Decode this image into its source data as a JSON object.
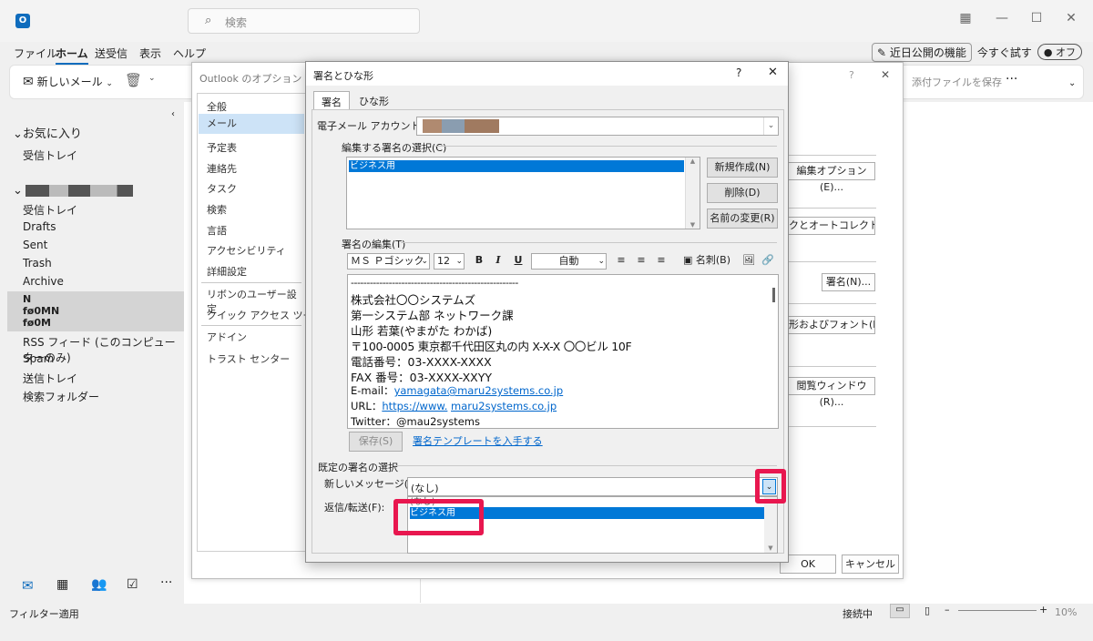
{
  "titlebar": {
    "search_placeholder": "検索"
  },
  "menu": {
    "file": "ファイル",
    "home": "ホーム",
    "sendrecv": "送受信",
    "view": "表示",
    "help": "ヘルプ"
  },
  "top_right": {
    "coming_soon": "近日公開の機能",
    "try_now": "今すぐ試す",
    "toggle": "オフ"
  },
  "ribbon": {
    "new_mail": "新しいメール",
    "save_attachment": "添付ファイルを保存",
    "more": "···"
  },
  "leftpane": {
    "favorites": "お気に入り",
    "fav_inbox": "受信トレイ",
    "folders": [
      "受信トレイ",
      "Drafts",
      "Sent",
      "Trash",
      "Archive"
    ],
    "sel_lines": [
      "N",
      "fø0MN",
      "fø0M"
    ],
    "more_folders": [
      "RSS フィード (このコンピューターのみ)",
      "Spam",
      "送信トレイ",
      "検索フォルダー"
    ]
  },
  "status": {
    "left": "フィルター適用",
    "connected": "接続中",
    "zoom": "10%"
  },
  "options": {
    "title": "Outlook のオプション",
    "nav": [
      "全般",
      "メール",
      "予定表",
      "連絡先",
      "タスク",
      "検索",
      "言語",
      "アクセシビリティ",
      "詳細設定",
      "リボンのユーザー設定",
      "クイック アクセス ツール バー",
      "アドイン",
      "トラスト センター"
    ],
    "buttons": {
      "edit_options": "編集オプション(E)...",
      "autocorrect": "クとオートコレクト(S)...",
      "signature": "署名(N)...",
      "fonts": "形およびフォント(F)...",
      "reading": "閲覧ウィンドウ(R)..."
    },
    "ok": "OK",
    "cancel": "キャンセル"
  },
  "sig": {
    "title": "署名とひな形",
    "help": "?",
    "close": "✕",
    "tab_sig": "署名",
    "tab_tpl": "ひな形",
    "account_label": "電子メール アカウント(A):",
    "select_label": "編集する署名の選択(C)",
    "list_items": [
      "ビジネス用"
    ],
    "btn_new": "新規作成(N)",
    "btn_delete": "削除(D)",
    "btn_rename": "名前の変更(R)",
    "edit_label": "署名の編集(T)",
    "font": "ＭＳ Ｐゴシック",
    "size": "12",
    "color": "自動",
    "bizcard": "名刺(B)",
    "body": {
      "dash": "-----------------------------------------------------",
      "company": "株式会社〇〇システムズ",
      "dept": "第一システム部 ネットワーク課",
      "name": "山形 若葉(やまがた わかば)",
      "address": "〒100-0005 東京都千代田区丸の内 X-X-X 〇〇ビル 10F",
      "tel": "電話番号：03-XXXX-XXXX",
      "fax": "FAX 番号：03-XXXX-XXYY",
      "email_prefix": "E-mail：",
      "email": "yamagata@maru2systems.co.jp",
      "url_prefix": "URL：",
      "url1": "https://www.",
      "url2": "maru2systems.co.jp",
      "twitter": "Twitter：@mau2systems"
    },
    "save": "保存(S)",
    "template_link": "署名テンプレートを入手する",
    "default_label": "既定の署名の選択",
    "new_msg_label": "新しいメッセージ(M):",
    "new_msg_value": "(なし)",
    "reply_label": "返信/転送(F):",
    "dropdown_items": [
      "(なし)",
      "ビジネス用"
    ]
  },
  "colors": {
    "accent": "#0078d7",
    "highlight": "#e8174f"
  }
}
